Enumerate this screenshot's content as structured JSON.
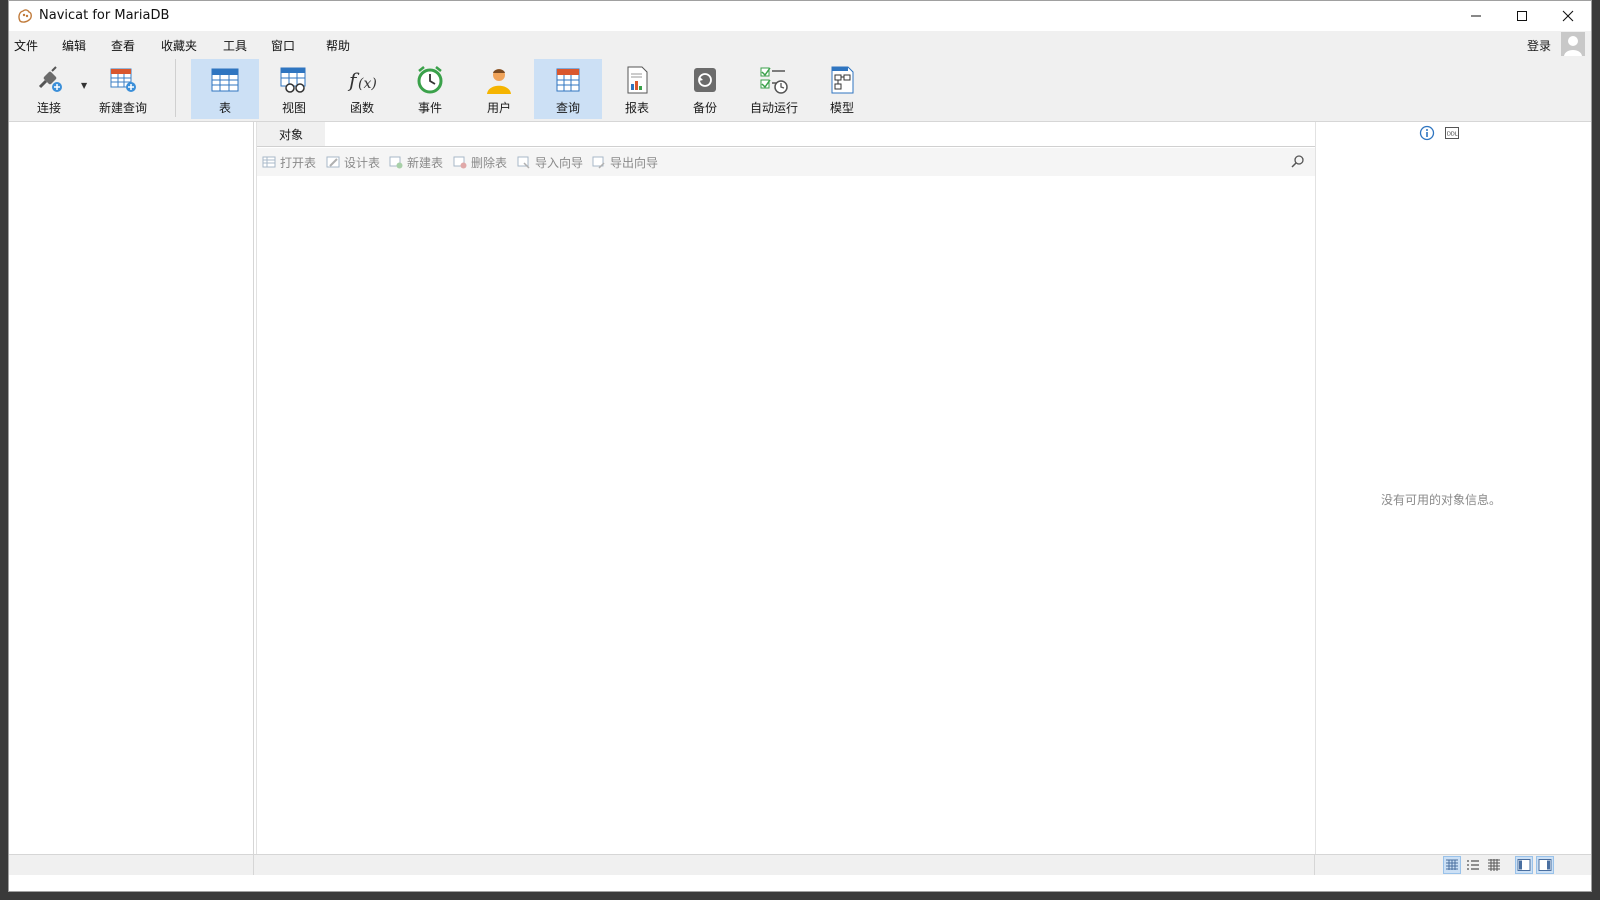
{
  "window": {
    "title": "Navicat for MariaDB"
  },
  "menu": {
    "items": [
      "文件",
      "编辑",
      "查看",
      "收藏夹",
      "工具",
      "窗口",
      "帮助"
    ],
    "login": "登录"
  },
  "toolbar": {
    "buttons": [
      {
        "label": "连接",
        "icon": "connection-plug-icon"
      },
      {
        "label": "新建查询",
        "icon": "new-query-icon"
      },
      {
        "label": "表",
        "icon": "table-icon",
        "active": true
      },
      {
        "label": "视图",
        "icon": "view-icon"
      },
      {
        "label": "函数",
        "icon": "function-icon"
      },
      {
        "label": "事件",
        "icon": "event-clock-icon"
      },
      {
        "label": "用户",
        "icon": "user-icon"
      },
      {
        "label": "查询",
        "icon": "query-icon",
        "active": true
      },
      {
        "label": "报表",
        "icon": "report-icon"
      },
      {
        "label": "备份",
        "icon": "backup-icon"
      },
      {
        "label": "自动运行",
        "icon": "automation-icon"
      },
      {
        "label": "模型",
        "icon": "model-icon"
      }
    ]
  },
  "objects": {
    "tab_label": "对象",
    "actions": [
      {
        "label": "打开表",
        "icon": "open-table-icon"
      },
      {
        "label": "设计表",
        "icon": "design-table-icon"
      },
      {
        "label": "新建表",
        "icon": "new-table-icon"
      },
      {
        "label": "删除表",
        "icon": "delete-table-icon"
      },
      {
        "label": "导入向导",
        "icon": "import-wizard-icon"
      },
      {
        "label": "导出向导",
        "icon": "export-wizard-icon"
      }
    ]
  },
  "info_panel": {
    "empty_message": "没有可用的对象信息。"
  },
  "colors": {
    "accent_active": "#cce0f5",
    "toolbar_bg": "#f0f0f0",
    "disabled_text": "#8a8a8a"
  }
}
